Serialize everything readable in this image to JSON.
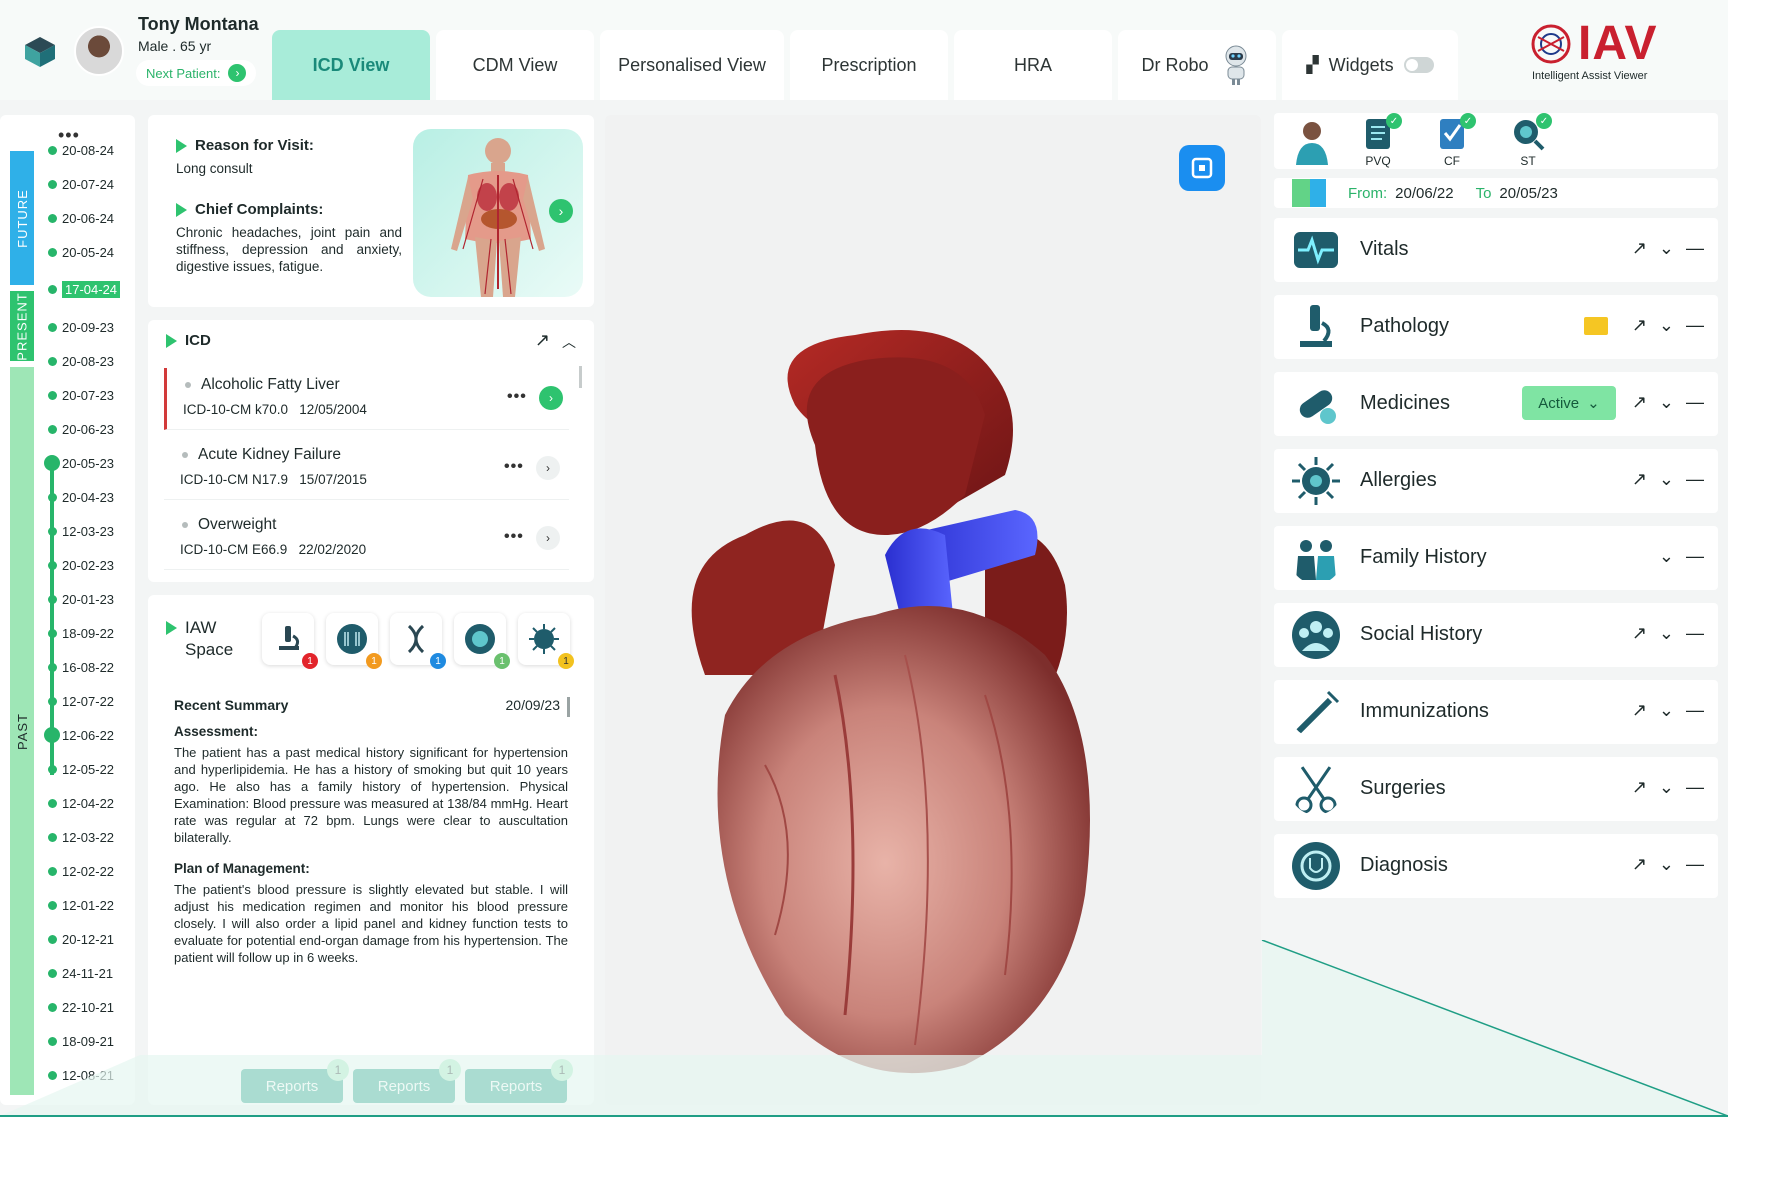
{
  "patient": {
    "name": "Tony Montana",
    "meta": "Male . 65 yr",
    "next_label": "Next Patient:"
  },
  "tabs": [
    {
      "label": "ICD View"
    },
    {
      "label": "CDM View"
    },
    {
      "label": "Personalised View"
    },
    {
      "label": "Prescription"
    },
    {
      "label": "HRA"
    },
    {
      "label": "Dr Robo"
    },
    {
      "label": "Widgets"
    }
  ],
  "brand": {
    "name": "IAV",
    "sub": "Intelligent Assist Viewer"
  },
  "timeline": {
    "more": "•••",
    "future": "FUTURE",
    "present": "PRESENT",
    "past": "PAST",
    "dates": [
      "20-08-24",
      "20-07-24",
      "20-06-24",
      "20-05-24",
      "17-04-24",
      "20-09-23",
      "20-08-23",
      "20-07-23",
      "20-06-23",
      "20-05-23",
      "20-04-23",
      "12-03-23",
      "20-02-23",
      "20-01-23",
      "18-09-22",
      "16-08-22",
      "12-07-22",
      "12-06-22",
      "12-05-22",
      "12-04-22",
      "12-03-22",
      "12-02-22",
      "12-01-22",
      "20-12-21",
      "24-11-21",
      "22-10-21",
      "18-09-21",
      "12-08-21"
    ]
  },
  "reason": {
    "title": "Reason for Visit:",
    "text": "Long consult",
    "complaints_title": "Chief Complaints:",
    "complaints_text": "Chronic headaches, joint pain and stiffness, depression and anxiety, digestive issues, fatigue."
  },
  "icd": {
    "title": "ICD",
    "items": [
      {
        "name": "Alcoholic Fatty Liver",
        "code": "ICD-10-CM k70.0",
        "date": "12/05/2004"
      },
      {
        "name": "Acute Kidney Failure",
        "code": "ICD-10-CM N17.9",
        "date": "15/07/2015"
      },
      {
        "name": "Overweight",
        "code": "ICD-10-CM E66.9",
        "date": "22/02/2020"
      }
    ]
  },
  "iaw": {
    "title_line1": "IAW",
    "title_line2": "Space",
    "badges": [
      "1",
      "1",
      "1",
      "1",
      "1"
    ],
    "summary_title": "Recent Summary",
    "summary_date": "20/09/23",
    "assessment_title": "Assessment:",
    "assessment_text": "The patient has a past medical history significant for hypertension and hyperlipidemia. He has a history of smoking but quit 10 years ago. He also has a family history of hypertension. Physical Examination: Blood pressure was measured at 138/84 mmHg. Heart rate was regular at 72 bpm. Lungs were clear to auscultation bilaterally.",
    "plan_title": "Plan of Management:",
    "plan_text": "The patient's blood pressure is slightly elevated but stable. I will adjust his medication regimen and monitor his blood pressure closely. I will also order a lipid panel and kidney function tests to evaluate for potential end-organ damage from his hypertension. The patient will follow up in 6 weeks.",
    "reports": [
      {
        "label": "Reports",
        "count": "1"
      },
      {
        "label": "Reports",
        "count": "1"
      },
      {
        "label": "Reports",
        "count": "1"
      }
    ]
  },
  "right": {
    "top_icons": [
      {
        "label": "PVQ"
      },
      {
        "label": "CF"
      },
      {
        "label": "ST"
      }
    ],
    "from_label": "From:",
    "from": "20/06/22",
    "to_label": "To",
    "to": "20/05/23",
    "sections": [
      {
        "name": "Vitals"
      },
      {
        "name": "Pathology"
      },
      {
        "name": "Medicines",
        "status": "Active"
      },
      {
        "name": "Allergies"
      },
      {
        "name": "Family History"
      },
      {
        "name": "Social History"
      },
      {
        "name": "Immunizations"
      },
      {
        "name": "Surgeries"
      },
      {
        "name": "Diagnosis"
      }
    ]
  },
  "colors": {
    "accent": "#2ec36f",
    "tab_active": "#a8ecd9",
    "teal": "#1f9e85",
    "brand_red": "#c9202f",
    "blue": "#1a8ef0"
  }
}
